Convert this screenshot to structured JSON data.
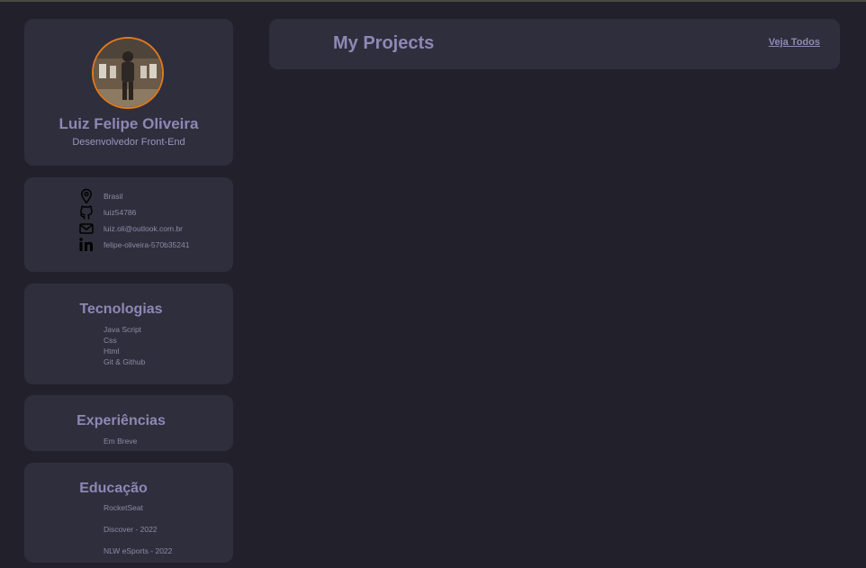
{
  "profile": {
    "name": "Luiz Felipe Oliveira",
    "role": "Desenvolvedor Front-End"
  },
  "contacts": [
    {
      "icon": "location-icon",
      "text": "Brasil"
    },
    {
      "icon": "github-icon",
      "text": "luiz54786"
    },
    {
      "icon": "mail-icon",
      "text": "luiz.oli@outlook.com.br"
    },
    {
      "icon": "linkedin-icon",
      "text": "felipe-oliveira-570b35241"
    }
  ],
  "technologies": {
    "title": "Tecnologias",
    "items": [
      "Java Script",
      "Css",
      "Html",
      "Git & Github"
    ]
  },
  "experiences": {
    "title": "Experiências",
    "items": [
      "Em Breve"
    ]
  },
  "education": {
    "title": "Educação",
    "items": [
      "RocketSeat",
      "Discover - 2022",
      "NLW eSports - 2022"
    ]
  },
  "projects": {
    "title": "My Projects",
    "link_label": "Veja Todos"
  },
  "colors": {
    "background": "#22212b",
    "card": "#2f2e3c",
    "accent_text": "#8f87b6",
    "avatar_ring": "#e07a1f"
  }
}
